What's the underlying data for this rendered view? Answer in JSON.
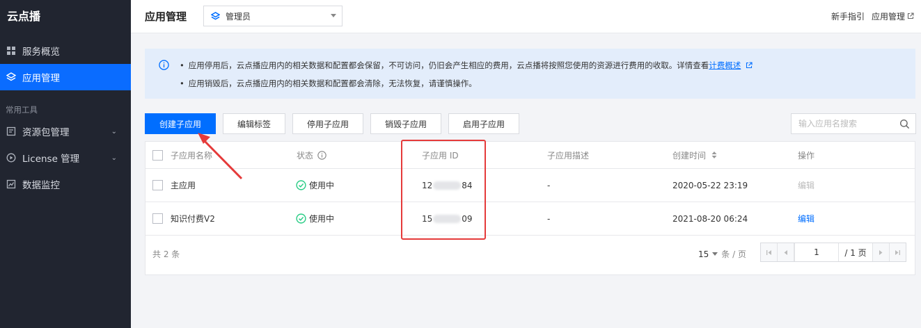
{
  "sidebar": {
    "brand": "云点播",
    "items": [
      {
        "label": "服务概览"
      },
      {
        "label": "应用管理"
      },
      {
        "label": "资源包管理"
      },
      {
        "label": "License 管理"
      },
      {
        "label": "数据监控"
      }
    ],
    "section_label": "常用工具"
  },
  "topbar": {
    "title": "应用管理",
    "role_select_value": "管理员",
    "link_guide": "新手指引",
    "link_app_manage": "应用管理"
  },
  "notice": {
    "line1_text": "应用停用后，云点播应用内的相关数据和配置都会保留，不可访问，仍旧会产生相应的费用，云点播将按照您使用的资源进行费用的收取。详情查看",
    "line1_link": "计费概述",
    "line2_text": "应用销毁后，云点播应用内的相关数据和配置都会清除，无法恢复，请谨慎操作。",
    "bullet": "•"
  },
  "toolbar": {
    "create_label": "创建子应用",
    "edit_tags_label": "编辑标签",
    "disable_label": "停用子应用",
    "destroy_label": "销毁子应用",
    "enable_label": "启用子应用",
    "search_placeholder": "输入应用名搜索"
  },
  "table": {
    "headers": {
      "name": "子应用名称",
      "status": "状态",
      "app_id": "子应用 ID",
      "desc": "子应用描述",
      "created": "创建时间",
      "action": "操作"
    },
    "rows": [
      {
        "name": "主应用",
        "status": "使用中",
        "id_prefix": "12",
        "id_suffix": "84",
        "desc": "-",
        "created": "2020-05-22 23:19",
        "action": "编辑"
      },
      {
        "name": "知识付费V2",
        "status": "使用中",
        "id_prefix": "15",
        "id_suffix": "09",
        "desc": "-",
        "created": "2021-08-20 06:24",
        "action": "编辑"
      }
    ]
  },
  "footer": {
    "total": "共 2 条",
    "page_size": "15",
    "page_size_unit": "条 / 页",
    "current_page": "1",
    "total_pages": "/ 1 页"
  },
  "colors": {
    "sidebar_bg": "#212530",
    "accent": "#006eff",
    "notice_bg": "#e3edfb",
    "status_green": "#29cc85",
    "annotation_red": "#e53a3a"
  }
}
